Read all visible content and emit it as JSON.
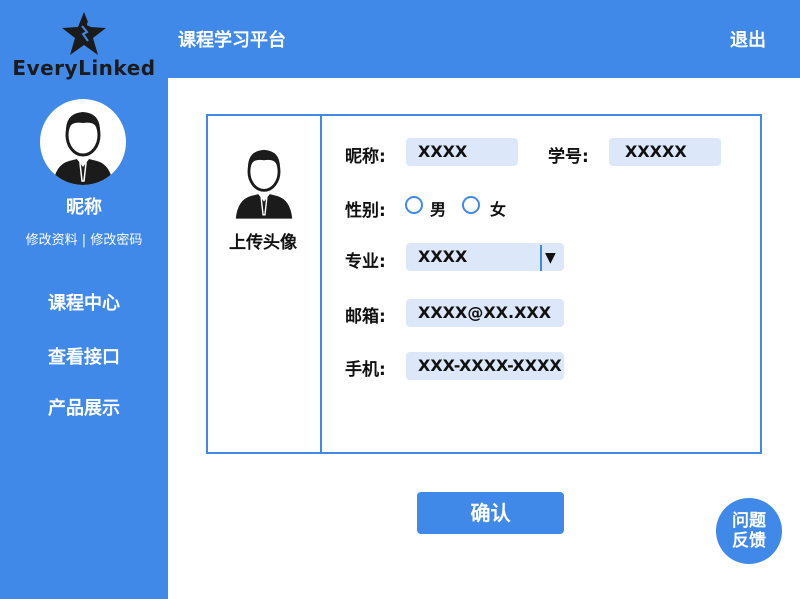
{
  "brand": {
    "logo_text": "EveryLinked",
    "logo_icon": "star-logo-icon"
  },
  "header": {
    "title": "课程学习平台",
    "logout_label": "退出"
  },
  "sidebar": {
    "nickname": "昵称",
    "edit_profile": "修改资料",
    "separator": "|",
    "change_password": "修改密码",
    "nav": [
      {
        "label": "课程中心"
      },
      {
        "label": "查看接口"
      },
      {
        "label": "产品展示"
      }
    ]
  },
  "form": {
    "upload_avatar_label": "上传头像",
    "nickname_label": "昵称:",
    "nickname_value": "XXXX",
    "student_id_label": "学号:",
    "student_id_value": "XXXXX",
    "gender_label": "性别:",
    "gender_options": [
      "男",
      "女"
    ],
    "major_label": "专业:",
    "major_value": "XXXX",
    "select_arrow": "▼",
    "email_label": "邮箱:",
    "email_value": "XXXX@XX.XXX",
    "phone_label": "手机:",
    "phone_value": "XXX-XXXX-XXXX"
  },
  "confirm_label": "确认",
  "feedback": {
    "line1": "问题",
    "line2": "反馈"
  },
  "colors": {
    "primary": "#4189e8",
    "field_bg": "#dce8fa",
    "text": "#111111",
    "background": "#ffffff"
  }
}
